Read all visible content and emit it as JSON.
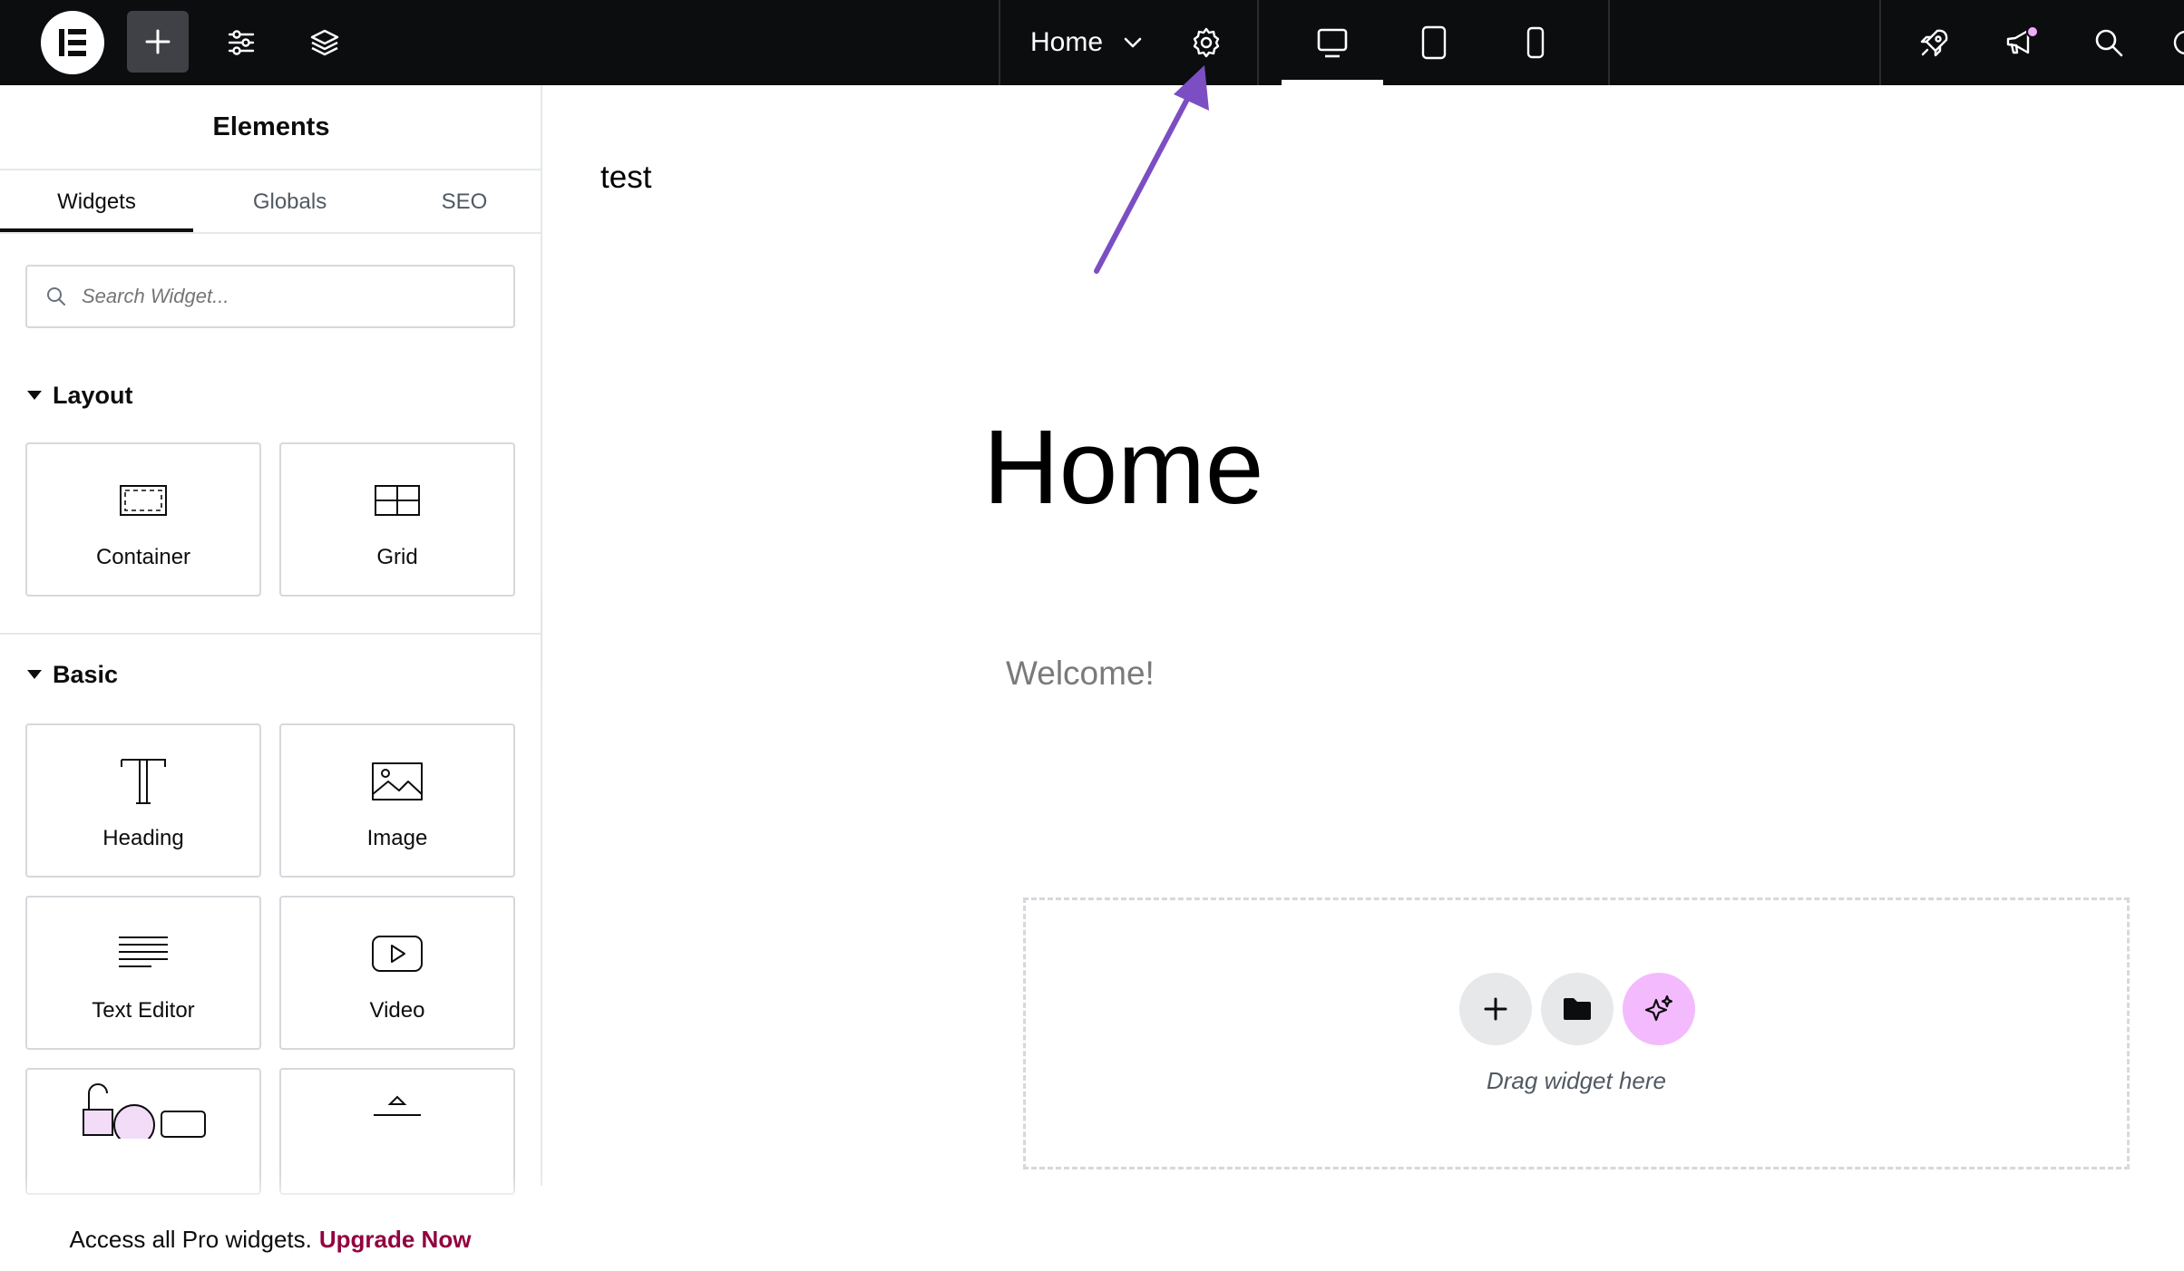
{
  "topbar": {
    "document_title": "Home",
    "colors": {
      "background": "#0c0d0e",
      "notification_dot": "#f0abfc"
    },
    "icons": [
      "elementor-logo-icon",
      "plus-icon",
      "sliders-icon",
      "layers-icon",
      "chevron-down-icon",
      "gear-icon",
      "desktop-icon",
      "tablet-icon",
      "mobile-icon",
      "rocket-icon",
      "megaphone-icon",
      "search-icon"
    ],
    "active_device": "desktop"
  },
  "panel": {
    "title": "Elements",
    "tabs": [
      {
        "label": "Widgets",
        "active": true
      },
      {
        "label": "Globals",
        "active": false
      },
      {
        "label": "SEO",
        "active": false
      }
    ],
    "search": {
      "placeholder": "Search Widget..."
    },
    "sections": [
      {
        "title": "Layout",
        "widgets": [
          {
            "label": "Container",
            "icon": "container-icon"
          },
          {
            "label": "Grid",
            "icon": "grid-icon"
          }
        ]
      },
      {
        "title": "Basic",
        "widgets": [
          {
            "label": "Heading",
            "icon": "heading-icon"
          },
          {
            "label": "Image",
            "icon": "image-icon"
          },
          {
            "label": "Text Editor",
            "icon": "text-editor-icon"
          },
          {
            "label": "Video",
            "icon": "video-icon"
          }
        ]
      }
    ],
    "promo": {
      "text": "Access all Pro widgets.",
      "link": "Upgrade Now",
      "link_color": "#93003f"
    }
  },
  "canvas": {
    "site_title": "test",
    "heading": "Home",
    "text": "Welcome!",
    "dropzone": {
      "text": "Drag widget here",
      "ai_button_color": "#f3bafd"
    }
  },
  "annotation": {
    "arrow_color": "#7b4fc3",
    "points_to": "gear-icon"
  }
}
